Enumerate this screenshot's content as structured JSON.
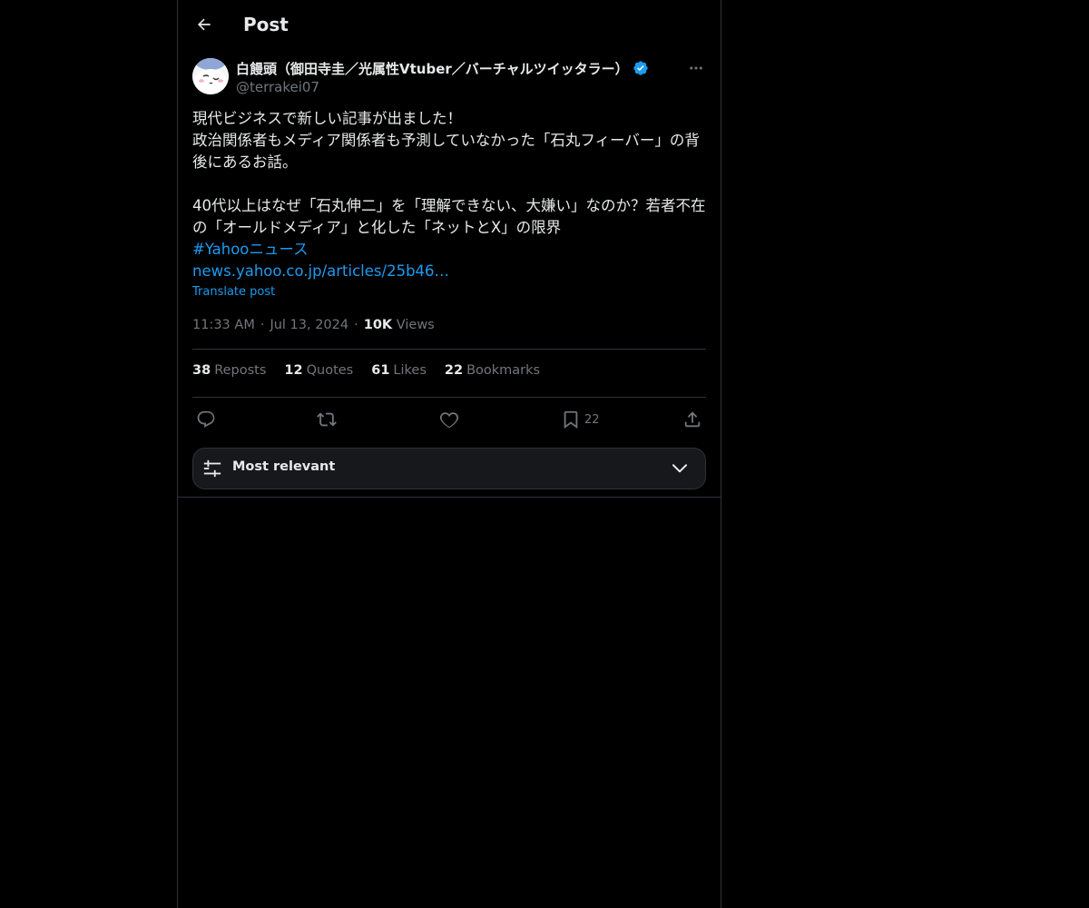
{
  "header": {
    "title": "Post"
  },
  "tweet": {
    "display_name": "白饅頭（御田寺圭／光属性Vtuber／バーチャルツイッタラー）",
    "handle": "@terrakei07",
    "body_lines": [
      "現代ビジネスで新しい記事が出ました！",
      "政治関係者もメディア関係者も予測していなかった「石丸フィーバー」の背後にあるお話。",
      "40代以上はなぜ「石丸伸二」を「理解できない、大嫌い」なのか？若者不在の「オールドメディア」と化した「ネットとX」の限界"
    ],
    "hashtag": "#Yahooニュース",
    "link": "news.yahoo.co.jp/articles/25b46…",
    "translate_label": "Translate post",
    "time": "11:33 AM",
    "date": "Jul 13, 2024",
    "views_count": "10K",
    "views_label": "Views"
  },
  "stats": [
    {
      "count": "38",
      "label": "Reposts"
    },
    {
      "count": "12",
      "label": "Quotes"
    },
    {
      "count": "61",
      "label": "Likes"
    },
    {
      "count": "22",
      "label": "Bookmarks"
    }
  ],
  "actions": {
    "bookmark_count": "22"
  },
  "sort": {
    "label": "Most relevant"
  },
  "colors": {
    "background": "#000000",
    "text": "#e7e9ea",
    "muted": "#71767b",
    "accent": "#1d9bf0",
    "border": "#2f3336"
  }
}
